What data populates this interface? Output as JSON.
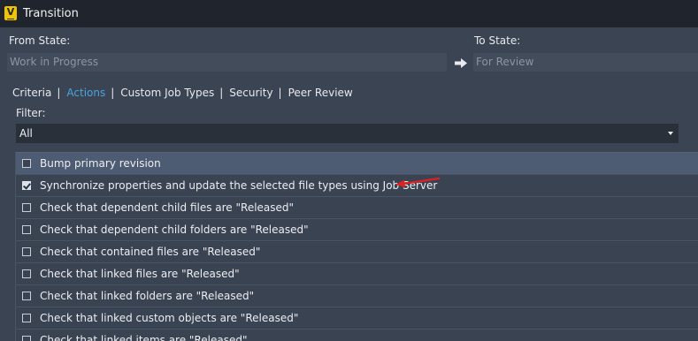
{
  "window": {
    "title": "Transition",
    "icon": "vault-app-icon"
  },
  "from_state": {
    "label": "From State:",
    "value": "Work in Progress"
  },
  "to_state": {
    "label": "To State:",
    "value": "For Review"
  },
  "tabs": [
    {
      "label": "Criteria",
      "active": false
    },
    {
      "label": "Actions",
      "active": true
    },
    {
      "label": "Custom Job Types",
      "active": false
    },
    {
      "label": "Security",
      "active": false
    },
    {
      "label": "Peer Review",
      "active": false
    }
  ],
  "filter": {
    "label": "Filter:",
    "value": "All"
  },
  "actions": [
    {
      "label": "Bump primary revision",
      "checked": false,
      "selected": true
    },
    {
      "label": "Synchronize properties and update the selected file types using Job Server",
      "checked": true,
      "selected": false
    },
    {
      "label": "Check that dependent child files are \"Released\"",
      "checked": false,
      "selected": false
    },
    {
      "label": "Check that dependent child folders are \"Released\"",
      "checked": false,
      "selected": false
    },
    {
      "label": "Check that contained files are \"Released\"",
      "checked": false,
      "selected": false
    },
    {
      "label": "Check that linked files are \"Released\"",
      "checked": false,
      "selected": false
    },
    {
      "label": "Check that linked folders are \"Released\"",
      "checked": false,
      "selected": false
    },
    {
      "label": "Check that linked custom objects are \"Released\"",
      "checked": false,
      "selected": false
    },
    {
      "label": "Check that linked items are \"Released\"",
      "checked": false,
      "selected": false
    }
  ],
  "colors": {
    "active_tab": "#4aa3df",
    "annotation_arrow": "#e02020"
  }
}
